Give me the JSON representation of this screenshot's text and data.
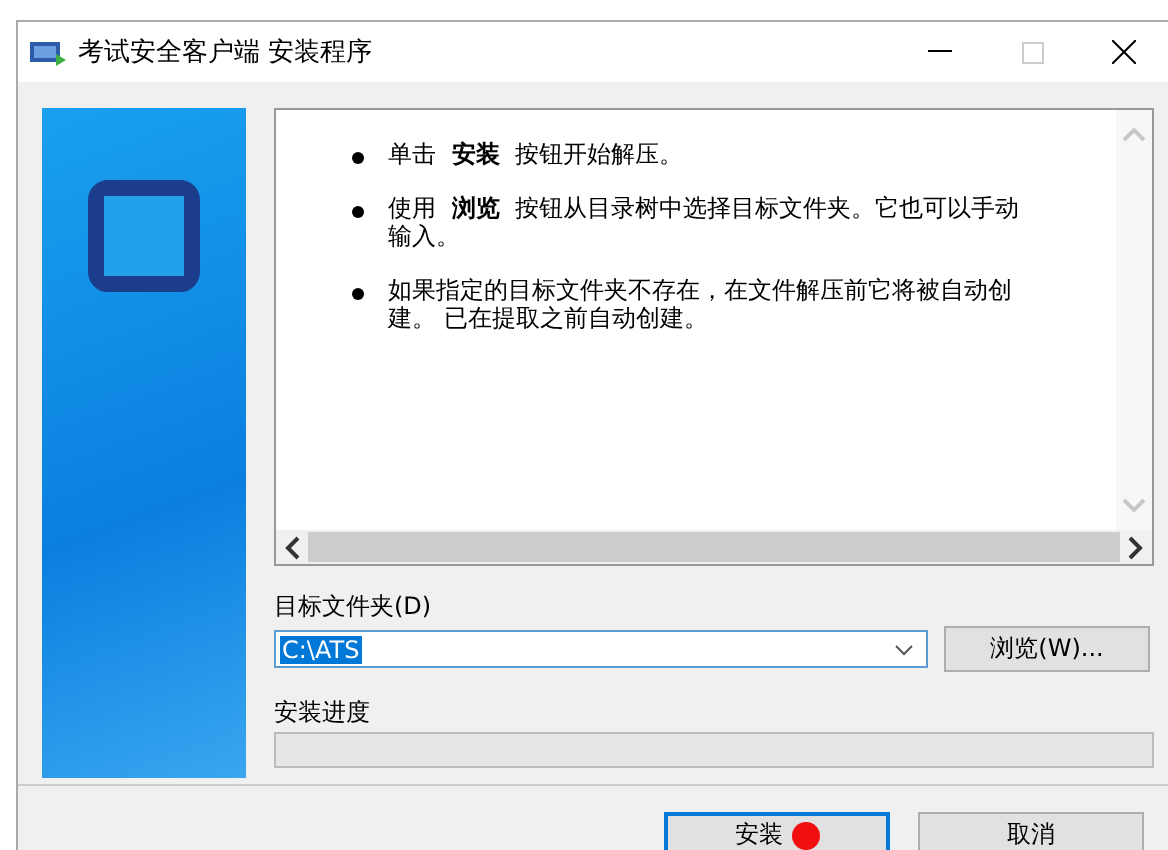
{
  "window": {
    "title": "考试安全客户端 安装程序"
  },
  "instructions": [
    "单击 **安装** 按钮开始解压。",
    "使用 **浏览** 按钮从目录树中选择目标文件夹。它也可以手动输入。",
    "如果指定的目标文件夹不存在，在文件解压前它将被自动创建。 已在提取之前自动创建。"
  ],
  "target_folder": {
    "label": "目标文件夹(D)",
    "value": "C:\\ATS",
    "browse_button": "浏览(W)..."
  },
  "progress": {
    "label": "安装进度",
    "level": 0
  },
  "buttons": [
    {
      "label": "安装",
      "default": true
    },
    {
      "label": "取消",
      "default": false
    }
  ]
}
